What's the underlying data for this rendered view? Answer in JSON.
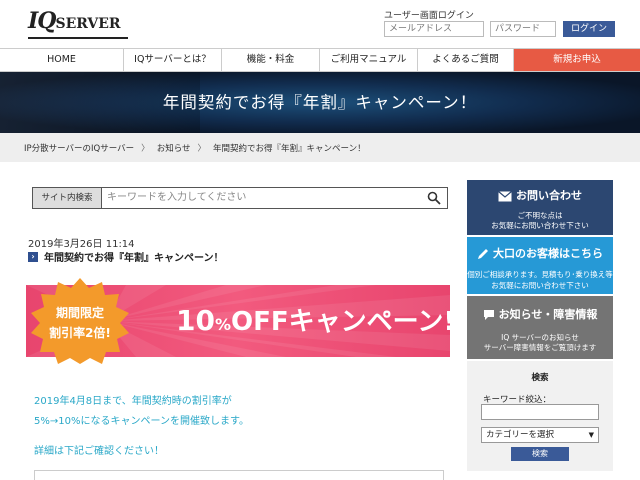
{
  "header": {
    "logo_iq": "IQ",
    "logo_server": "SERVER",
    "login_label": "ユーザー画面ログイン",
    "email_placeholder": "メールアドレス",
    "password_placeholder": "パスワード",
    "login_button": "ログイン"
  },
  "nav": {
    "items": [
      {
        "label": "HOME"
      },
      {
        "label": "IQサーバーとは？"
      },
      {
        "label": "機能・料金"
      },
      {
        "label": "ご利用マニュアル"
      },
      {
        "label": "よくあるご質問"
      },
      {
        "label": "新規お申込"
      }
    ]
  },
  "banner": {
    "title": "年間契約でお得『年割』キャンペーン！"
  },
  "breadcrumb": {
    "items": [
      "IP分散サーバーのIQサーバー",
      "お知らせ",
      "年間契約でお得『年割』キャンペーン！"
    ],
    "separator": "〉"
  },
  "search": {
    "label": "サイト内検索",
    "placeholder": "キーワードを入力してください"
  },
  "post": {
    "date": "2019年3月26日 11:14",
    "title": "年間契約でお得『年割』キャンペーン！"
  },
  "campaign": {
    "badge_line1": "期間限定",
    "badge_line2": "割引率2倍!",
    "big": "10",
    "pct": "%",
    "rest": "OFFキャンペーン!!"
  },
  "body": {
    "line1": "2019年4月8日まで、年間契約時の割引率が",
    "line2": "5%→10%になるキャンペーンを開催致します。",
    "line3": "詳細は下記ご確認ください！"
  },
  "sidebar": {
    "contact": {
      "title": "お問い合わせ",
      "sub1": "ご不明な点は",
      "sub2": "お気軽にお問い合わせ下さい"
    },
    "big_customer": {
      "title": "大口のお客様はこちら",
      "sub1": "個別ご相談承ります。見積もり･乗り換え等",
      "sub2": "お気軽にお問い合わせ下さい"
    },
    "news": {
      "title": "お知らせ・障害情報",
      "sub1": "IQ サーバーのお知らせ",
      "sub2": "サーバー障害情報をご覧頂けます"
    },
    "search": {
      "title": "検索",
      "keyword_label": "キーワード絞込：",
      "category_selected": "カテゴリーを選択",
      "button": "検索"
    }
  },
  "colors": {
    "navy": "#2c4771",
    "accent_red": "#e75a44",
    "sky": "#2699d6",
    "campaign_pink": "#e8456e",
    "badge_orange": "#f39a2b",
    "body_text": "#2aa8c8"
  }
}
